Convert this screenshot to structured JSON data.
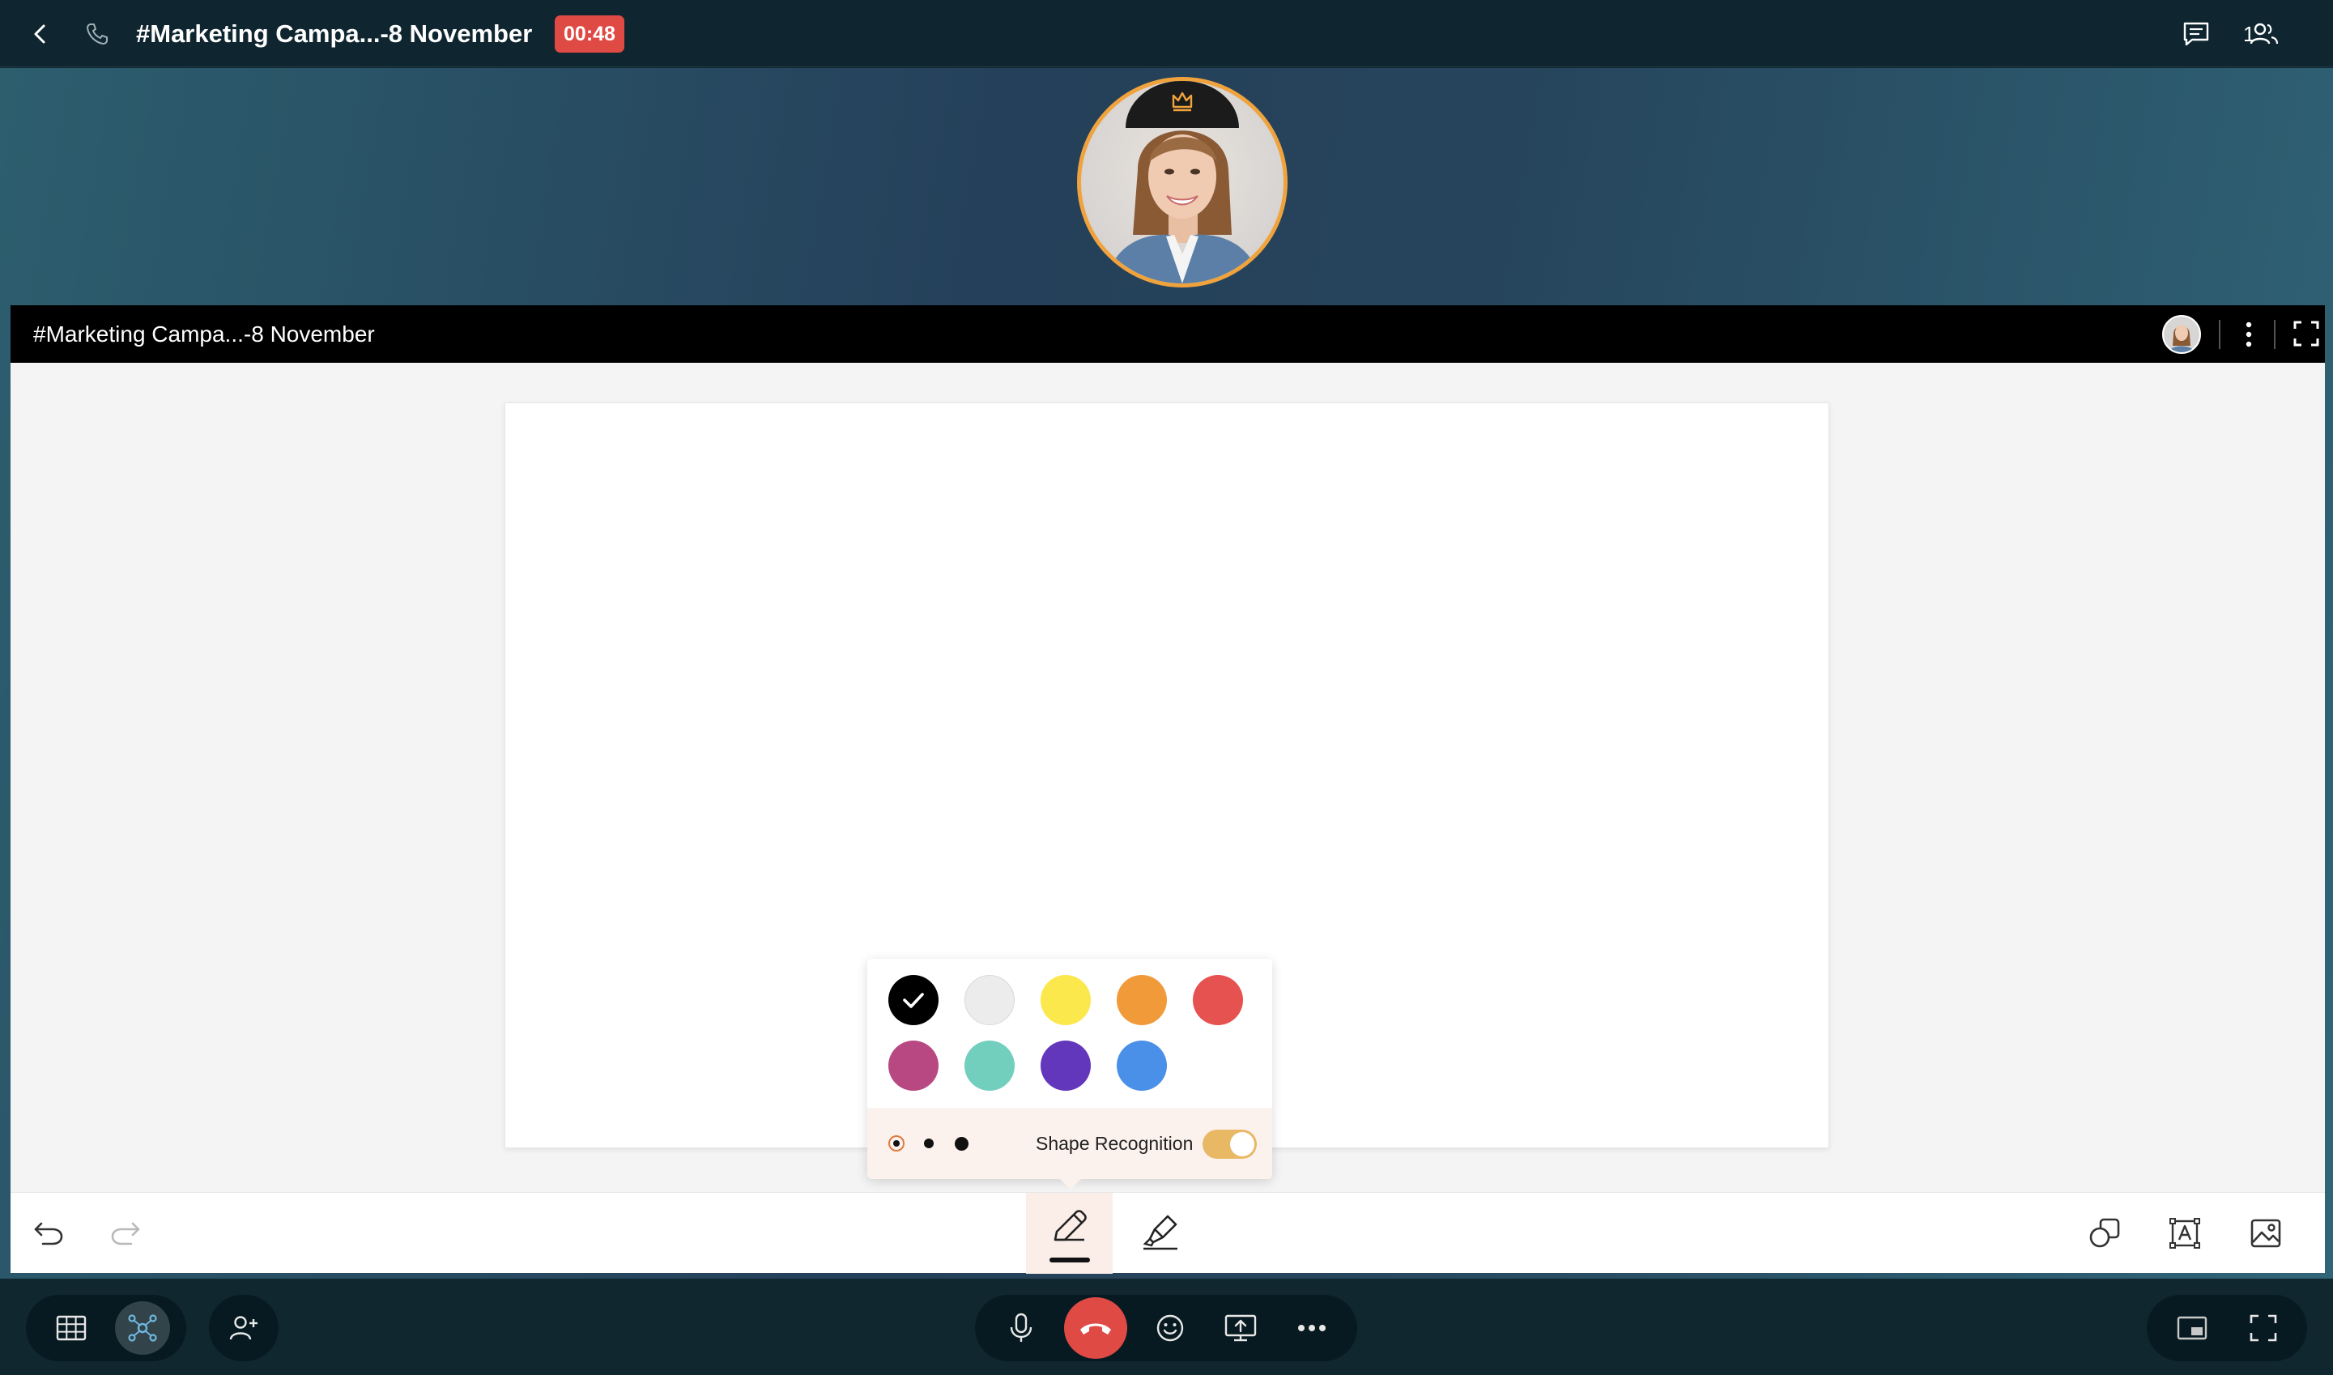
{
  "header": {
    "title": "#Marketing Campa...-8 November",
    "timer": "00:48",
    "participant_count": "1",
    "icons": [
      "back-arrow-icon",
      "phone-icon",
      "chat-icon",
      "participants-icon"
    ]
  },
  "whiteboard": {
    "title": "#Marketing Campa...-8 November",
    "header_icons": [
      "participant-avatar",
      "more-vertical-icon",
      "fullscreen-icon"
    ]
  },
  "pen_popover": {
    "colors": [
      "#000000",
      "#ececec",
      "#fbe84c",
      "#f09a3a",
      "#e5524f",
      "#b84882",
      "#73cfbd",
      "#6237bc",
      "#4a90e8"
    ],
    "selected_color": "#000000",
    "stroke_sizes": [
      "small",
      "medium",
      "large"
    ],
    "selected_stroke": "small",
    "shape_recognition_label": "Shape Recognition",
    "shape_recognition_on": true
  },
  "toolbar": {
    "left_tools": [
      "undo-icon",
      "redo-icon"
    ],
    "center_tools": [
      "pen-icon",
      "highlighter-icon"
    ],
    "active_tool": "pen",
    "right_tools": [
      "shapes-icon",
      "text-box-icon",
      "image-icon"
    ]
  },
  "call_bar": {
    "left": [
      "grid-view-icon",
      "whiteboard-view-icon",
      "add-participant-icon"
    ],
    "center": [
      "microphone-icon",
      "end-call-icon",
      "emoji-icon",
      "screen-share-icon",
      "more-horizontal-icon"
    ],
    "right": [
      "picture-in-picture-icon",
      "fullscreen-icon"
    ]
  },
  "colors": {
    "accent": "#f0a33d",
    "timer_badge": "#e04a44",
    "end_call": "#e04a44",
    "toggle_on": "#e9b865"
  }
}
